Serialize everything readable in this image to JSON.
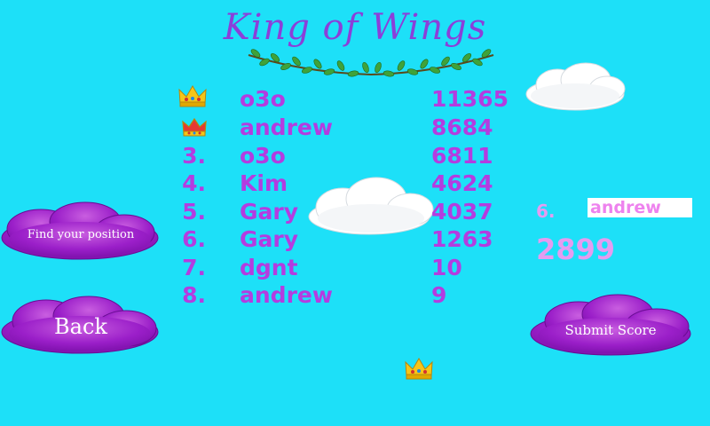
{
  "title": "King of Wings",
  "leaderboard": [
    {
      "rank": "",
      "name": "o3o",
      "score": "11365",
      "icon": "gold-crown-icon"
    },
    {
      "rank": "",
      "name": "andrew",
      "score": "8684",
      "icon": "red-crown-icon"
    },
    {
      "rank": "3.",
      "name": "o3o",
      "score": "6811"
    },
    {
      "rank": "4.",
      "name": "Kim",
      "score": "4624"
    },
    {
      "rank": "5.",
      "name": "Gary",
      "score": "4037"
    },
    {
      "rank": "6.",
      "name": "Gary",
      "score": "1263"
    },
    {
      "rank": "7.",
      "name": "dgnt",
      "score": "10"
    },
    {
      "rank": "8.",
      "name": "andrew",
      "score": "9"
    }
  ],
  "player": {
    "rank": "6.",
    "name_value": "andrew",
    "score": "2899"
  },
  "buttons": {
    "find_position": "Find your position",
    "back": "Back",
    "submit": "Submit Score"
  },
  "colors": {
    "background": "#1de0f8",
    "text": "#b43ce0",
    "player_text": "#e49cf0",
    "button_purple": "#9b1fc9",
    "title": "#8b3fd9"
  },
  "icons": [
    "gold-crown-icon",
    "red-crown-icon",
    "cloud-icon",
    "vine-icon"
  ]
}
